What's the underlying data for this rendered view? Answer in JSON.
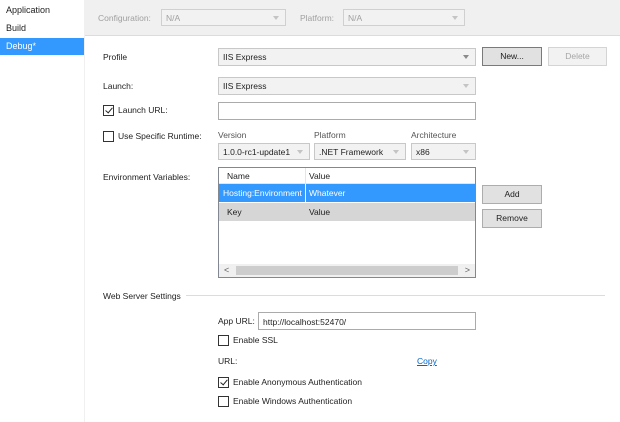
{
  "sidebar": {
    "items": [
      {
        "label": "Application"
      },
      {
        "label": "Build"
      },
      {
        "label": "Debug*"
      }
    ]
  },
  "toolbar": {
    "configuration_label": "Configuration:",
    "configuration_value": "N/A",
    "platform_label": "Platform:",
    "platform_value": "N/A"
  },
  "profile": {
    "label": "Profile",
    "value": "IIS Express",
    "new_button": "New...",
    "delete_button": "Delete"
  },
  "launch": {
    "label": "Launch:",
    "value": "IIS Express"
  },
  "launch_url": {
    "label": "Launch URL:",
    "checked": true,
    "value": ""
  },
  "runtime": {
    "label": "Use Specific Runtime:",
    "checked": false,
    "version_header": "Version",
    "platform_header": "Platform",
    "architecture_header": "Architecture",
    "version_value": "1.0.0-rc1-update1",
    "platform_value": ".NET Framework",
    "architecture_value": "x86"
  },
  "env": {
    "label": "Environment Variables:",
    "columns": [
      "Name",
      "Value"
    ],
    "rows": [
      {
        "name": "Hosting:Environment",
        "value": "Whatever",
        "selected": true
      },
      {
        "name": "Key",
        "value": "Value",
        "selected": false
      }
    ],
    "add_button": "Add",
    "remove_button": "Remove",
    "scroll_left": "<",
    "scroll_right": ">"
  },
  "web_server": {
    "section_title": "Web Server Settings",
    "app_url_label": "App URL:",
    "app_url_value": "http://localhost:52470/",
    "enable_ssl_label": "Enable SSL",
    "enable_ssl_checked": false,
    "url_label": "URL:",
    "copy_link": "Copy",
    "anon_auth_label": "Enable Anonymous Authentication",
    "anon_auth_checked": true,
    "windows_auth_label": "Enable Windows Authentication",
    "windows_auth_checked": false
  },
  "colors": {
    "accent": "#3399ff",
    "selected_row": "#3399ff",
    "gray_row": "#d6d6d6"
  }
}
